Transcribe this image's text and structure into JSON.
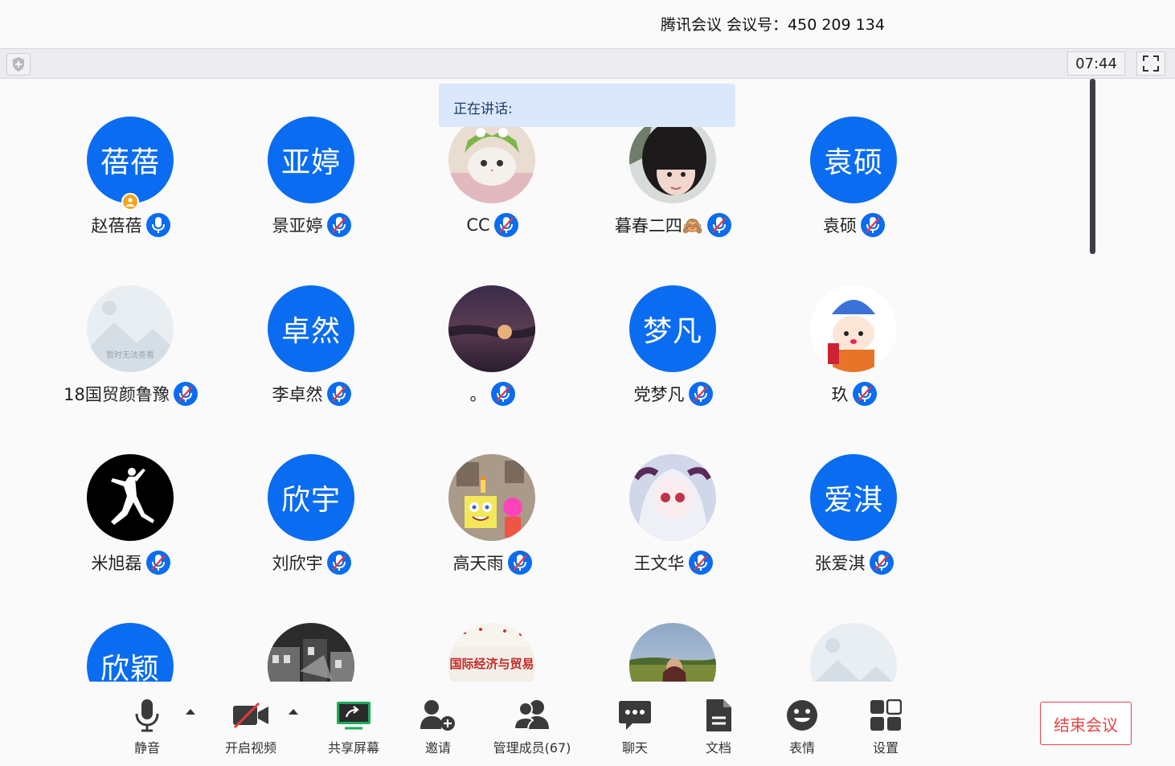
{
  "window": {
    "title": "腾讯会议 会议号：450 209 134"
  },
  "toolbar": {
    "timer": "07:44"
  },
  "speaking_banner": "正在讲话:",
  "participants": [
    {
      "name": "赵蓓蓓",
      "avatar_text": "蓓蓓",
      "avatar": "text",
      "mic": "on",
      "host": true
    },
    {
      "name": "景亚婷",
      "avatar_text": "亚婷",
      "avatar": "text",
      "mic": "muted"
    },
    {
      "name": "CC",
      "avatar": "photo-cat",
      "mic": "muted"
    },
    {
      "name": "暮春二四🙈",
      "avatar": "photo-girl",
      "mic": "muted"
    },
    {
      "name": "袁硕",
      "avatar_text": "袁硕",
      "avatar": "text",
      "mic": "muted"
    },
    {
      "name": "18国贸颜鲁豫",
      "avatar": "placeholder",
      "placeholder_text": "暂时无法查看",
      "mic": "muted"
    },
    {
      "name": "李卓然",
      "avatar_text": "卓然",
      "avatar": "text",
      "mic": "muted"
    },
    {
      "name": "。",
      "avatar": "photo-moon",
      "mic": "muted"
    },
    {
      "name": "党梦凡",
      "avatar_text": "梦凡",
      "avatar": "text",
      "mic": "muted"
    },
    {
      "name": "玖",
      "avatar": "photo-cartoon",
      "mic": "muted"
    },
    {
      "name": "米旭磊",
      "avatar": "photo-jumpman",
      "mic": "muted"
    },
    {
      "name": "刘欣宇",
      "avatar_text": "欣宇",
      "avatar": "text",
      "mic": "muted"
    },
    {
      "name": "高天雨",
      "avatar": "photo-sponge",
      "mic": "muted"
    },
    {
      "name": "王文华",
      "avatar": "photo-anime",
      "mic": "muted"
    },
    {
      "name": "张爱淇",
      "avatar_text": "爱淇",
      "avatar": "text",
      "mic": "muted"
    },
    {
      "name": "",
      "avatar_text": "欣颖",
      "avatar": "text",
      "mic": "none"
    },
    {
      "name": "",
      "avatar": "photo-street",
      "mic": "none"
    },
    {
      "name": "",
      "avatar": "photo-book",
      "book_text": "国际经济与贸易",
      "mic": "none"
    },
    {
      "name": "",
      "avatar": "photo-field",
      "mic": "none"
    },
    {
      "name": "",
      "avatar": "placeholder",
      "mic": "none"
    }
  ],
  "bottombar": {
    "mute": "静音",
    "video": "开启视频",
    "share": "共享屏幕",
    "invite": "邀请",
    "members": "管理成员(67)",
    "chat": "聊天",
    "docs": "文档",
    "emoji": "表情",
    "settings": "设置",
    "end": "结束会议"
  },
  "colors": {
    "accent": "#0a6cf0",
    "danger": "#e64545",
    "share": "#1aad5a"
  }
}
